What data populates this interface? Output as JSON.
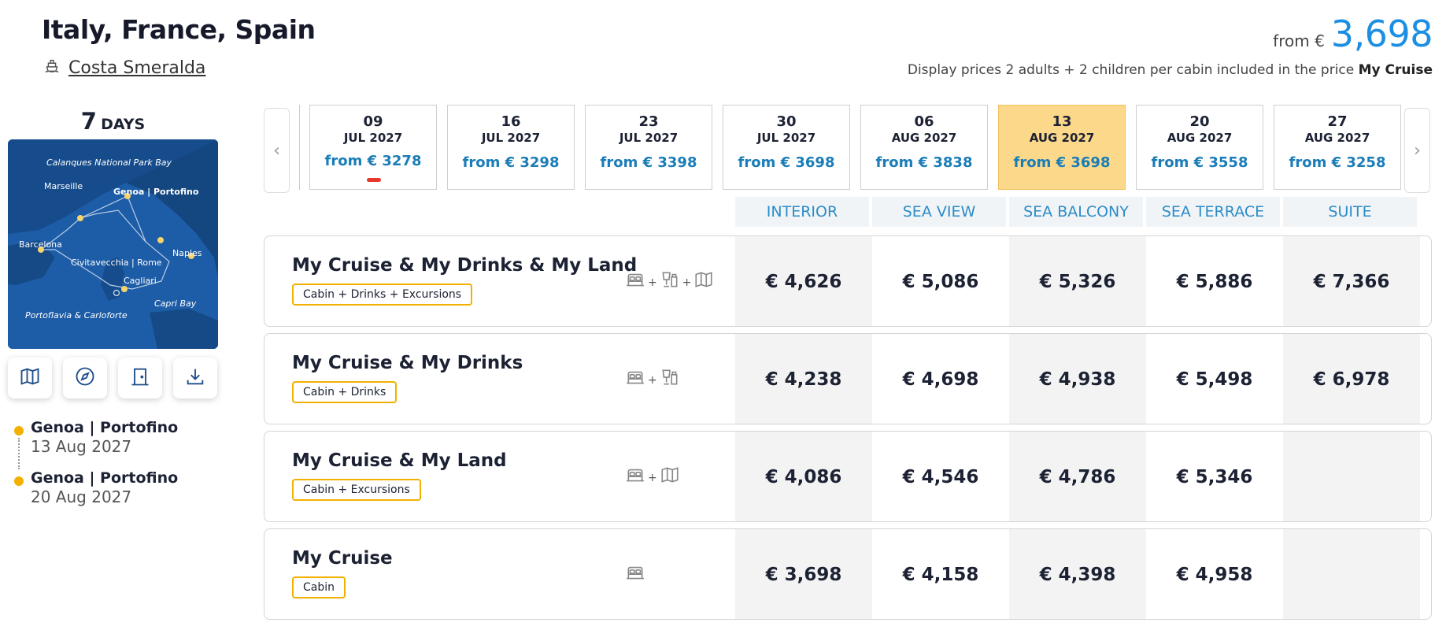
{
  "header": {
    "title": "Italy, France, Spain",
    "ship_name": "Costa Smeralda",
    "price_from_label": "from €",
    "price_from_value": "3,698",
    "price_note": "Display prices 2 adults + 2 children per cabin included in the price",
    "price_note_bold": "My Cruise"
  },
  "left": {
    "days_num": "7",
    "days_label": "DAYS",
    "map_labels": {
      "calanques": "Calanques National Park Bay",
      "marseille": "Marseille",
      "genoa": "Genoa | Portofino",
      "barcelona": "Barcelona",
      "civitavecchia": "Civitavecchia | Rome",
      "naples": "Naples",
      "cagliari": "Cagliari",
      "capri": "Capri Bay",
      "portoflavia": "Portoflavia & Carloforte"
    },
    "tools": [
      "map-icon",
      "compass-icon",
      "door-icon",
      "download-icon"
    ],
    "route": [
      {
        "port": "Genoa | Portofino",
        "date": "13 Aug 2027"
      },
      {
        "port": "Genoa | Portofino",
        "date": "20 Aug 2027"
      }
    ]
  },
  "dates": [
    {
      "day": "09",
      "month": "JUL 2027",
      "from": "from € 3278"
    },
    {
      "day": "16",
      "month": "JUL 2027",
      "from": "from € 3298"
    },
    {
      "day": "23",
      "month": "JUL 2027",
      "from": "from € 3398"
    },
    {
      "day": "30",
      "month": "JUL 2027",
      "from": "from € 3698"
    },
    {
      "day": "06",
      "month": "AUG 2027",
      "from": "from € 3838"
    },
    {
      "day": "13",
      "month": "AUG 2027",
      "from": "from € 3698"
    },
    {
      "day": "20",
      "month": "AUG 2027",
      "from": "from € 3558"
    },
    {
      "day": "27",
      "month": "AUG 2027",
      "from": "from € 3258"
    }
  ],
  "selected_date_index": 5,
  "columns": [
    "INTERIOR",
    "SEA VIEW",
    "SEA BALCONY",
    "SEA TERRACE",
    "SUITE"
  ],
  "packages": [
    {
      "name": "My Cruise & My Drinks & My Land",
      "badge": "Cabin + Drinks + Excursions",
      "icons": [
        "bed-icon",
        "drinks-icon",
        "map-icon"
      ],
      "prices": [
        "€ 4,626",
        "€ 5,086",
        "€ 5,326",
        "€ 5,886",
        "€ 7,366"
      ]
    },
    {
      "name": "My Cruise & My Drinks",
      "badge": "Cabin + Drinks",
      "icons": [
        "bed-icon",
        "drinks-icon"
      ],
      "prices": [
        "€ 4,238",
        "€ 4,698",
        "€ 4,938",
        "€ 5,498",
        "€ 6,978"
      ]
    },
    {
      "name": "My Cruise & My Land",
      "badge": "Cabin + Excursions",
      "icons": [
        "bed-icon",
        "map-icon"
      ],
      "prices": [
        "€ 4,086",
        "€ 4,546",
        "€ 4,786",
        "€ 5,346",
        ""
      ]
    },
    {
      "name": "My Cruise",
      "badge": "Cabin",
      "icons": [
        "bed-icon"
      ],
      "prices": [
        "€ 3,698",
        "€ 4,158",
        "€ 4,398",
        "€ 4,958",
        ""
      ]
    }
  ],
  "carousel": {
    "prev": "‹",
    "next": "›"
  },
  "colors": {
    "accent_blue": "#1d8fe3",
    "header_blue": "#2b8cc8",
    "selected_date": "#fcd98a",
    "badge_border": "#f2b100",
    "indicator": "#e8372b"
  }
}
